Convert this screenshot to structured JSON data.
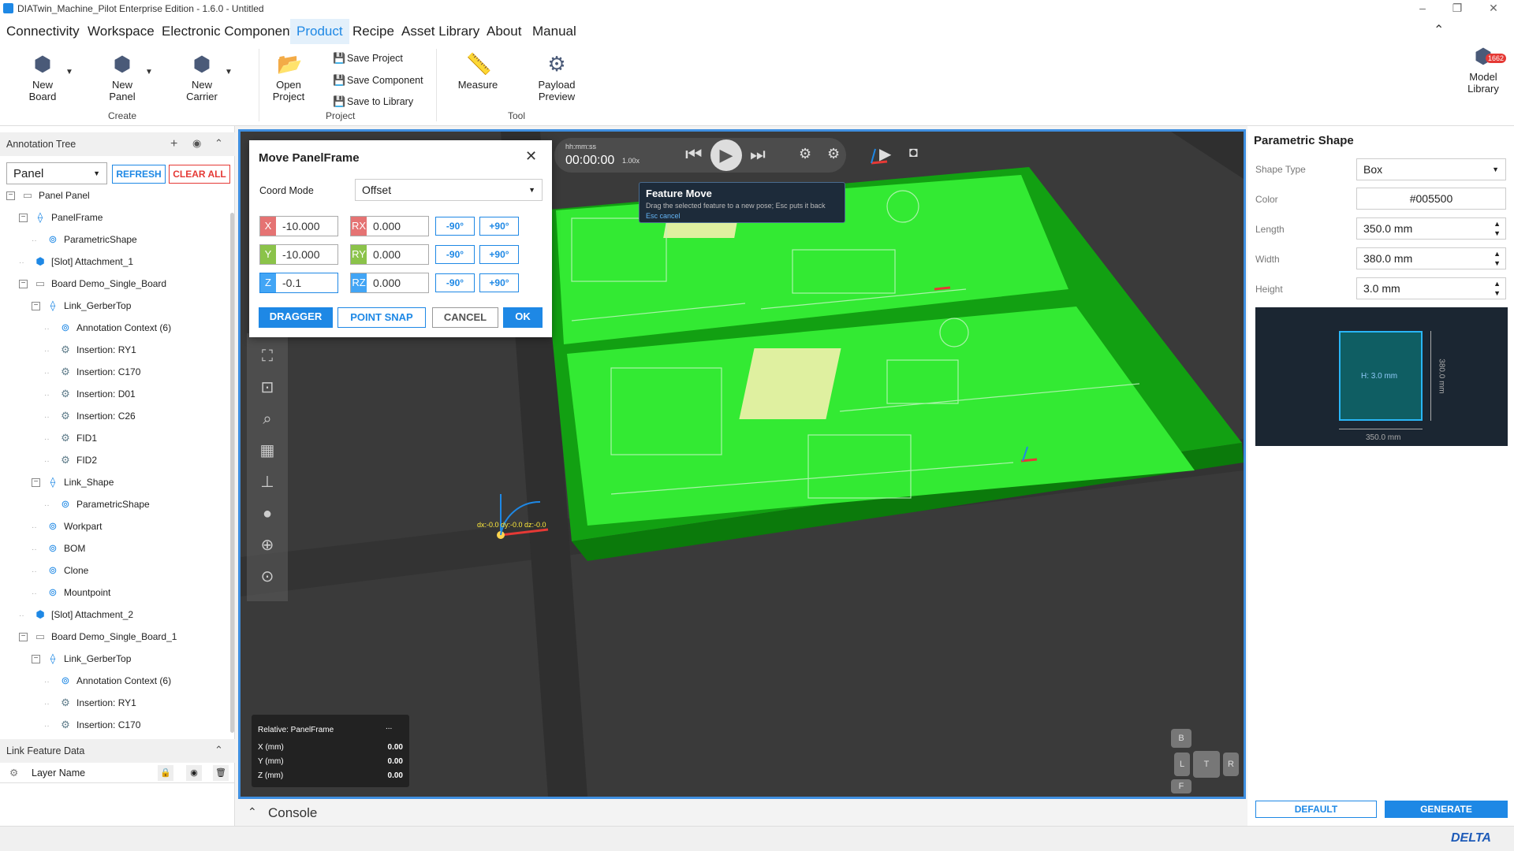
{
  "window": {
    "title": "DIATwin_Machine_Pilot Enterprise Edition - 1.6.0 - Untitled"
  },
  "menu": [
    "Connectivity",
    "Workspace",
    "Electronic Component",
    "Product",
    "Recipe",
    "Asset Library",
    "About",
    "Manual"
  ],
  "active_menu": "Product",
  "ribbon": {
    "new_board": "New\nBoard",
    "new_panel": "New\nPanel",
    "new_carrier": "New\nCarrier",
    "group_create": "Create",
    "open_project": "Open\nProject",
    "save_project": "Save Project",
    "save_component": "Save Component",
    "save_library": "Save to Library",
    "group_project": "Project",
    "measure": "Measure",
    "payload_preview": "Payload\nPreview",
    "group_tool": "Tool",
    "model_library": "Model\nLibrary",
    "model_library_badge": "1662"
  },
  "left": {
    "annotation_tree": "Annotation Tree",
    "selector": "Panel",
    "refresh": "REFRESH",
    "clear_all": "CLEAR ALL",
    "link_feature_data": "Link Feature Data",
    "layer_name": "Layer Name",
    "tree": [
      {
        "label": "Panel  Panel",
        "icon": "folder-icon",
        "depth": 0,
        "exp": "−"
      },
      {
        "label": "PanelFrame",
        "icon": "link-icon",
        "depth": 1,
        "exp": "−"
      },
      {
        "label": "ParametricShape",
        "icon": "shape-icon",
        "depth": 2,
        "exp": ""
      },
      {
        "label": "[Slot] Attachment_1",
        "icon": "cube-icon",
        "depth": 1,
        "exp": ""
      },
      {
        "label": "Board  Demo_Single_Board",
        "icon": "folder-icon",
        "depth": 1,
        "exp": "−"
      },
      {
        "label": "Link_GerberTop",
        "icon": "link-icon",
        "depth": 2,
        "exp": "−"
      },
      {
        "label": "Annotation Context (6)",
        "icon": "shape-icon",
        "depth": 3,
        "exp": ""
      },
      {
        "label": "Insertion: RY1",
        "icon": "component-icon",
        "depth": 3,
        "exp": ""
      },
      {
        "label": "Insertion: C170",
        "icon": "component-icon",
        "depth": 3,
        "exp": ""
      },
      {
        "label": "Insertion: D01",
        "icon": "component-icon",
        "depth": 3,
        "exp": ""
      },
      {
        "label": "Insertion: C26",
        "icon": "component-icon",
        "depth": 3,
        "exp": ""
      },
      {
        "label": "FID1",
        "icon": "component-icon",
        "depth": 3,
        "exp": ""
      },
      {
        "label": "FID2",
        "icon": "component-icon",
        "depth": 3,
        "exp": ""
      },
      {
        "label": "Link_Shape",
        "icon": "link-icon",
        "depth": 2,
        "exp": "−"
      },
      {
        "label": "ParametricShape",
        "icon": "shape-icon",
        "depth": 3,
        "exp": ""
      },
      {
        "label": "Workpart",
        "icon": "shape-icon",
        "depth": 2,
        "exp": ""
      },
      {
        "label": "BOM",
        "icon": "shape-icon",
        "depth": 2,
        "exp": ""
      },
      {
        "label": "Clone",
        "icon": "shape-icon",
        "depth": 2,
        "exp": ""
      },
      {
        "label": "Mountpoint",
        "icon": "shape-icon",
        "depth": 2,
        "exp": ""
      },
      {
        "label": "[Slot] Attachment_2",
        "icon": "cube-icon",
        "depth": 1,
        "exp": ""
      },
      {
        "label": "Board  Demo_Single_Board_1",
        "icon": "folder-icon",
        "depth": 1,
        "exp": "−"
      },
      {
        "label": "Link_GerberTop",
        "icon": "link-icon",
        "depth": 2,
        "exp": "−"
      },
      {
        "label": "Annotation Context (6)",
        "icon": "shape-icon",
        "depth": 3,
        "exp": ""
      },
      {
        "label": "Insertion: RY1",
        "icon": "component-icon",
        "depth": 3,
        "exp": ""
      },
      {
        "label": "Insertion: C170",
        "icon": "component-icon",
        "depth": 3,
        "exp": ""
      }
    ]
  },
  "dialog": {
    "title": "Move PanelFrame",
    "coord_mode_label": "Coord Mode",
    "coord_mode": "Offset",
    "x": "-10.000",
    "y": "-10.000",
    "z": "-0.1",
    "rx": "0.000",
    "ry": "0.000",
    "rz": "0.000",
    "minus90": "-90°",
    "plus90": "+90°",
    "dragger": "DRAGGER",
    "point_snap": "POINT SNAP",
    "cancel": "CANCEL",
    "ok": "OK",
    "labels": {
      "x": "X",
      "y": "Y",
      "z": "Z",
      "rx": "RX",
      "ry": "RY",
      "rz": "RZ"
    }
  },
  "player": {
    "time_label": "hh:mm:ss",
    "time": "00:00:00",
    "speed": "1.00x"
  },
  "tooltip": {
    "title": "Feature Move",
    "body": "Drag the selected feature to a new pose; Esc puts it back",
    "hint": "Esc cancel"
  },
  "readout": {
    "title": "Relative: PanelFrame",
    "menu": "...",
    "x_label": "X (mm)",
    "x": "0.00",
    "y_label": "Y (mm)",
    "y": "0.00",
    "z_label": "Z (mm)",
    "z": "0.00"
  },
  "navcube": {
    "b": "B",
    "l": "L",
    "t": "T",
    "r": "R",
    "f": "F"
  },
  "gizmo_label": "dx:-0.0  dy:-0.0  dz:-0.0",
  "console": "Console",
  "right": {
    "title": "Parametric Shape",
    "shape_type_label": "Shape Type",
    "shape_type": "Box",
    "color_label": "Color",
    "color": "#005500",
    "length_label": "Length",
    "length": "350.0 mm",
    "width_label": "Width",
    "width": "380.0 mm",
    "height_label": "Height",
    "height": "3.0 mm",
    "preview_height": "H: 3.0 mm",
    "preview_w": "350.0 mm",
    "preview_h": "380.0 mm",
    "default": "DEFAULT",
    "generate": "GENERATE"
  },
  "brand": "DELTA",
  "colors": {
    "accent": "#1e88e5",
    "board": "#2ee62e",
    "viewport_border": "#3f8fe0"
  }
}
